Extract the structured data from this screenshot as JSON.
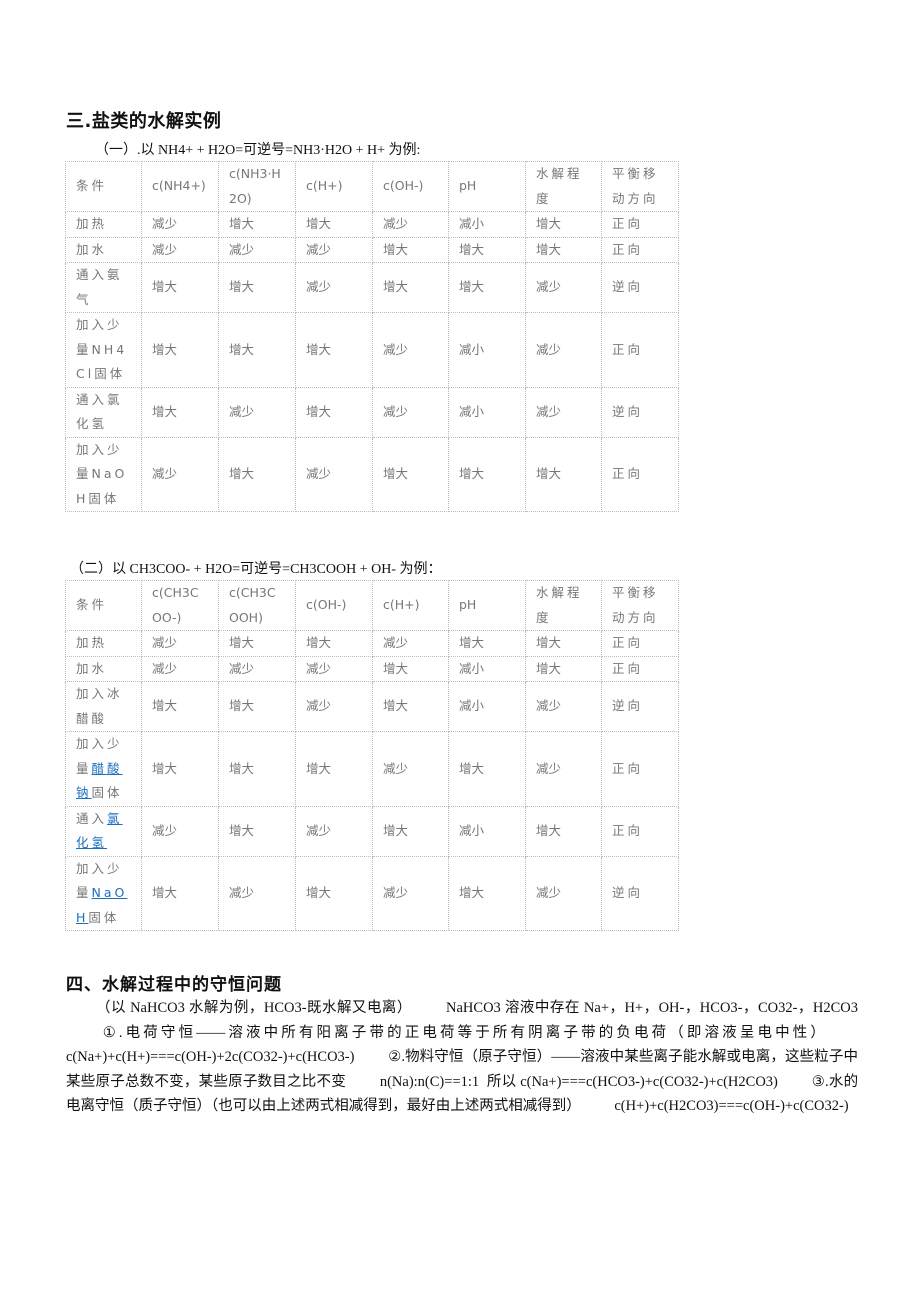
{
  "section3": {
    "title": "三.盐类的水解实例",
    "example1": {
      "caption": "（一）.以 NH4+ + H2O=可逆号=NH3·H2O + H+  为例:",
      "headers": [
        "条件",
        "c(NH4+)",
        "c(NH3·H2O)",
        "c(H+)",
        "c(OH-)",
        "pH",
        "水解程度",
        "平衡移动方向"
      ],
      "rows": [
        {
          "condition": "加热",
          "values": [
            "减少",
            "增大",
            "增大",
            "减少",
            "减小",
            "增大",
            "正向"
          ]
        },
        {
          "condition": "加水",
          "values": [
            "减少",
            "减少",
            "减少",
            "增大",
            "增大",
            "增大",
            "正向"
          ]
        },
        {
          "condition": "通入氨气",
          "values": [
            "增大",
            "增大",
            "减少",
            "增大",
            "增大",
            "减少",
            "逆向"
          ]
        },
        {
          "condition": "加入少量NH4Cl固体",
          "values": [
            "增大",
            "增大",
            "增大",
            "减少",
            "减小",
            "减少",
            "正向"
          ]
        },
        {
          "condition": "通入氯化氢",
          "values": [
            "增大",
            "减少",
            "增大",
            "减少",
            "减小",
            "减少",
            "逆向"
          ]
        },
        {
          "condition": "加入少量NaOH固体",
          "values": [
            "减少",
            "增大",
            "减少",
            "增大",
            "增大",
            "增大",
            "正向"
          ]
        }
      ]
    },
    "example2": {
      "caption": "（二）以 CH3COO- + H2O=可逆号=CH3COOH + OH-  为例：",
      "headers": [
        "条件",
        "c(CH3COO-)",
        "c(CH3COOH)",
        "c(OH-)",
        "c(H+)",
        "pH",
        "水解程度",
        "平衡移动方向"
      ],
      "rows": [
        {
          "condition": "加热",
          "values": [
            "减少",
            "增大",
            "增大",
            "减少",
            "增大",
            "增大",
            "正向"
          ]
        },
        {
          "condition": "加水",
          "values": [
            "减少",
            "减少",
            "减少",
            "增大",
            "减小",
            "增大",
            "正向"
          ]
        },
        {
          "condition": "加入冰醋酸",
          "values": [
            "增大",
            "增大",
            "减少",
            "增大",
            "减小",
            "减少",
            "逆向"
          ]
        },
        {
          "condition_prefix": "加入少量",
          "condition_link": "醋酸钠",
          "condition_suffix": "固体",
          "values": [
            "增大",
            "增大",
            "增大",
            "减少",
            "增大",
            "减少",
            "正向"
          ]
        },
        {
          "condition_prefix": "通入",
          "condition_link": "氯化氢",
          "condition_suffix": "",
          "values": [
            "减少",
            "增大",
            "减少",
            "增大",
            "减小",
            "增大",
            "正向"
          ]
        },
        {
          "condition_prefix": "加入少量",
          "condition_link": "NaOH",
          "condition_suffix": "固体",
          "values": [
            "增大",
            "减少",
            "增大",
            "减少",
            "增大",
            "减少",
            "逆向"
          ]
        }
      ]
    }
  },
  "section4": {
    "title": "四、水解过程中的守恒问题",
    "intro": "（以 NaHCO3 水解为例，HCO3-既水解又电离）",
    "species": "NaHCO3 溶液中存在 Na+，H+，OH-，HCO3-，CO32-，H2CO3",
    "charge_label": "①.电荷守恒——溶液中所有阳离子带的正电荷等于所有阴离子带的负电荷（即溶液呈电中性）",
    "charge_eq": "c(Na+)+c(H+)===c(OH-)+2c(CO32-)+c(HCO3-)",
    "material_label": "②.物料守恒（原子守恒）——溶液中某些离子能水解或电离，这些粒子中某些原子总数不变，某些原子数目之比不变",
    "material_ratio": "n(Na):n(C)==1:1",
    "material_so": "所以",
    "material_eq": "c(Na+)===c(HCO3-)+c(CO32-)+c(H2CO3)",
    "proton_label": "③.水的电离守恒（质子守恒）（也可以由上述两式相减得到，最好由上述两式相减得到）",
    "proton_eq": "c(H+)+c(H2CO3)===c(OH-)+c(CO32-)"
  },
  "colors": {
    "link": "#1a6fc0",
    "cell_text": "#777777",
    "border": "#bcbcbc"
  }
}
